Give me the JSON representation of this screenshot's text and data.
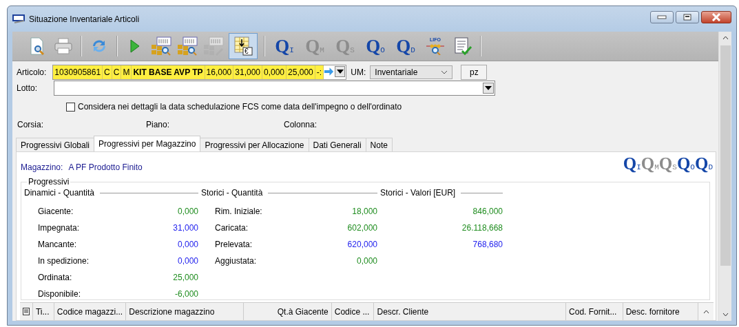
{
  "window": {
    "title": "Situazione Inventariale Articoli"
  },
  "toolbar": [
    {
      "kind": "preview",
      "disabled": false,
      "selected": false
    },
    {
      "kind": "print",
      "disabled": false,
      "selected": false
    },
    {
      "kind": "sep"
    },
    {
      "kind": "refresh",
      "disabled": false,
      "selected": false
    },
    {
      "kind": "sep"
    },
    {
      "kind": "play",
      "disabled": false,
      "selected": false
    },
    {
      "kind": "grid-search",
      "disabled": false,
      "selected": false
    },
    {
      "kind": "grid-search",
      "disabled": false,
      "selected": false
    },
    {
      "kind": "grid-edit",
      "disabled": true,
      "selected": false
    },
    {
      "kind": "grid-euro",
      "badge": "€",
      "disabled": false,
      "selected": true
    },
    {
      "kind": "sep"
    },
    {
      "kind": "q",
      "label": "Q$_{I}$",
      "disabled": false,
      "selected": false
    },
    {
      "kind": "q",
      "label": "Q$_{M}$",
      "disabled": true,
      "selected": false
    },
    {
      "kind": "q",
      "label": "Q$_{S}$",
      "disabled": true,
      "selected": false
    },
    {
      "kind": "q",
      "label": "Q$_{O}$",
      "disabled": false,
      "selected": false
    },
    {
      "kind": "q",
      "label": "Q$_{D}$",
      "disabled": false,
      "selected": false
    },
    {
      "kind": "lifo",
      "label": "LIFO",
      "disabled": false,
      "selected": false
    },
    {
      "kind": "checklist",
      "disabled": false,
      "selected": false
    }
  ],
  "articolo": {
    "label": "Articolo:",
    "cells": [
      {
        "text": "1030905861",
        "bold": false
      },
      {
        "text": "C",
        "bold": false
      },
      {
        "text": "C",
        "bold": false
      },
      {
        "text": "M",
        "bold": false
      },
      {
        "text": "KIT BASE AVP TP",
        "bold": true
      },
      {
        "text": "16,000",
        "bold": false
      },
      {
        "text": "31,000",
        "bold": false
      },
      {
        "text": "0,000",
        "bold": false
      },
      {
        "text": "25,000",
        "bold": false
      },
      {
        "text": "-:",
        "bold": false
      }
    ]
  },
  "um": {
    "label": "UM:",
    "value": "Inventariale",
    "unit": "pz"
  },
  "lotto": {
    "label": "Lotto:"
  },
  "option": {
    "label": "Considera nei dettagli la data schedulazione FCS come data dell'impegno o dell'ordinato",
    "checked": false
  },
  "location": [
    "Corsia:",
    "Piano:",
    "Colonna:"
  ],
  "tabs": [
    {
      "label": "Progressivi Globali",
      "selected": false
    },
    {
      "label": "Progressivi per Magazzino",
      "selected": true
    },
    {
      "label": "Progressivi per Allocazione",
      "selected": false
    },
    {
      "label": "Dati Generali",
      "selected": false
    },
    {
      "label": "Note",
      "selected": false
    }
  ],
  "magazzino": {
    "label": "Magazzino:",
    "value": "A PF Prodotto Finito"
  },
  "q_indicators": [
    {
      "label": "Q$_{I}$",
      "disabled": false
    },
    {
      "label": "Q$_{M}$",
      "disabled": true
    },
    {
      "label": "Q$_{S}$",
      "disabled": true
    },
    {
      "label": "Q$_{O}$",
      "disabled": false
    },
    {
      "label": "Q$_{D}$",
      "disabled": false
    }
  ],
  "progressivi": {
    "title": "Progressivi",
    "sections": [
      {
        "title": "Dinamici - Quantità",
        "rows": [
          {
            "label": "Giacente:",
            "value": "0,000",
            "color": "#1e8c1e"
          },
          {
            "label": "Impegnata:",
            "value": "31,000",
            "color": "#2222ee"
          },
          {
            "label": "Mancante:",
            "value": "0,000",
            "color": "#2222ee"
          },
          {
            "label": "In spedizione:",
            "value": "0,000",
            "color": "#2222ee"
          },
          {
            "label": "Ordinata:",
            "value": "25,000",
            "color": "#1e8c1e"
          },
          {
            "label": "Disponibile:",
            "value": "-6,000",
            "color": "#1e8c1e"
          }
        ]
      },
      {
        "title": "Storici - Quantità",
        "rows": [
          {
            "label": "Rim. Iniziale:",
            "value": "18,000",
            "color": "#1e8c1e"
          },
          {
            "label": "Caricata:",
            "value": "602,000",
            "color": "#1e8c1e"
          },
          {
            "label": "Prelevata:",
            "value": "620,000",
            "color": "#2222ee"
          },
          {
            "label": "Aggiustata:",
            "value": "0,000",
            "color": "#1e8c1e"
          }
        ]
      },
      {
        "title": "Storici - Valori [EUR]",
        "rows": [
          {
            "value": "846,000",
            "color": "#1e8c1e"
          },
          {
            "value": "26.118,668",
            "color": "#1e8c1e"
          },
          {
            "value": "768,680",
            "color": "#2222ee"
          }
        ]
      }
    ]
  },
  "table": {
    "columns": [
      {
        "label": "Ti...",
        "kind": "text"
      },
      {
        "label": "Codice magazzi...",
        "kind": "text"
      },
      {
        "label": "Descrizione magazzino",
        "kind": "text"
      },
      {
        "label": "Qt.à Giacente",
        "kind": "number"
      },
      {
        "label": "Codice ...",
        "kind": "text"
      },
      {
        "label": "Descr. Cliente",
        "kind": "text"
      },
      {
        "label": "Cod. Fornit...",
        "kind": "text"
      },
      {
        "label": "Desc. fornitore",
        "kind": "text"
      }
    ]
  }
}
